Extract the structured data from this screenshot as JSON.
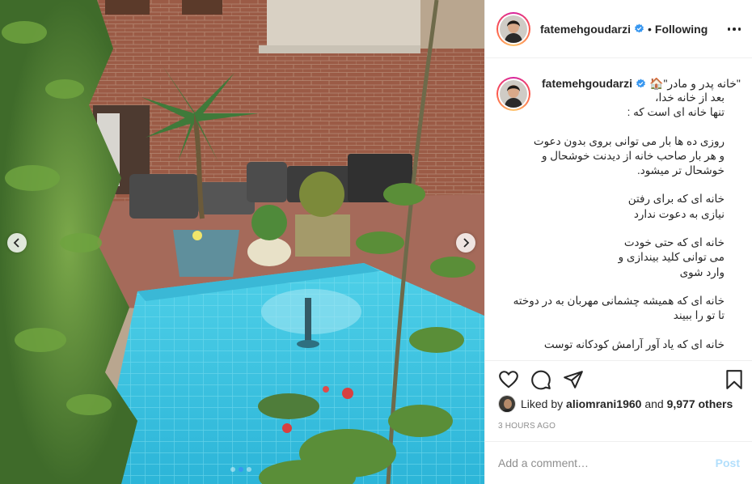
{
  "post": {
    "username": "fatemehgoudarzi",
    "verified": true,
    "separator": "•",
    "follow_status": "Following",
    "more_icon": "more-horizontal-icon"
  },
  "carousel": {
    "image_description_icon": "garden-courtyard-photo",
    "slide_count": 3,
    "active_slide": 2
  },
  "caption": {
    "username": "fatemehgoudarzi",
    "first_line": "\"خانه پدر و مادر\"🏠",
    "lines": [
      "بعد از خانه خدا،",
      "تنها خانه ای است که :",
      "",
      "روزی ده ها بار می توانی بروی بدون دعوت",
      "و هر بار صاحب خانه از دیدنت خوشحال و",
      "خوشحال تر میشود.",
      "",
      "خانه ای که برای رفتن",
      "نیازی به دعوت ندارد",
      "",
      "خانه ای که حتی خودت",
      "می توانی کلید بیندازی و",
      "وارد شوی",
      "",
      "خانه ای که همیشه چشمانی مهربان به در دوخته",
      "تا تو را ببیند",
      "",
      "خانه ای که یاد آور آرامش کودکانه توست"
    ]
  },
  "actions": {
    "like_icon": "heart-icon",
    "comment_icon": "comment-icon",
    "share_icon": "share-icon",
    "save_icon": "bookmark-icon"
  },
  "likes": {
    "prefix": "Liked by",
    "liker": "aliomrani1960",
    "and": "and",
    "others": "9,977 others"
  },
  "timestamp": "3 HOURS AGO",
  "comment_box": {
    "placeholder": "Add a comment…",
    "post_label": "Post"
  },
  "colors": {
    "verified_blue": "#3897f0",
    "post_disabled": "#b2dffc",
    "muted": "#8e8e8e"
  }
}
